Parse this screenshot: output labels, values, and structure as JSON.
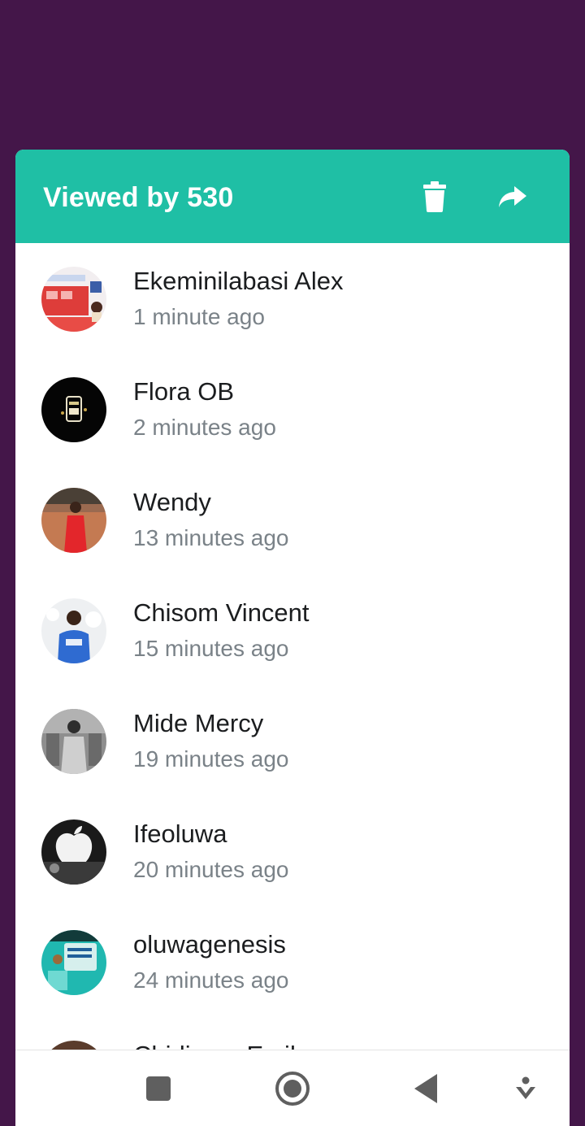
{
  "colors": {
    "backdrop": "#441649",
    "header": "#1fbfa5",
    "name_text": "#1b1d1f",
    "time_text": "#7a8288",
    "nav_icon": "#5f5f5f"
  },
  "header": {
    "title": "Viewed by 530",
    "delete_icon": "trash-icon",
    "forward_icon": "forward-arrow-icon"
  },
  "viewers": [
    {
      "name": "Ekeminilabasi Alex",
      "time": "1 minute ago"
    },
    {
      "name": "Flora OB",
      "time": "2 minutes ago"
    },
    {
      "name": "Wendy",
      "time": "13 minutes ago"
    },
    {
      "name": "Chisom Vincent",
      "time": "15 minutes ago"
    },
    {
      "name": "Mide Mercy",
      "time": "19 minutes ago"
    },
    {
      "name": "Ifeoluwa",
      "time": "20 minutes ago"
    },
    {
      "name": "oluwagenesis",
      "time": "24 minutes ago"
    },
    {
      "name": "Chidinma Emil",
      "time": ""
    }
  ],
  "nav": {
    "items": [
      "recents-square-icon",
      "home-circle-icon",
      "back-triangle-icon",
      "dropdown-icon"
    ]
  }
}
